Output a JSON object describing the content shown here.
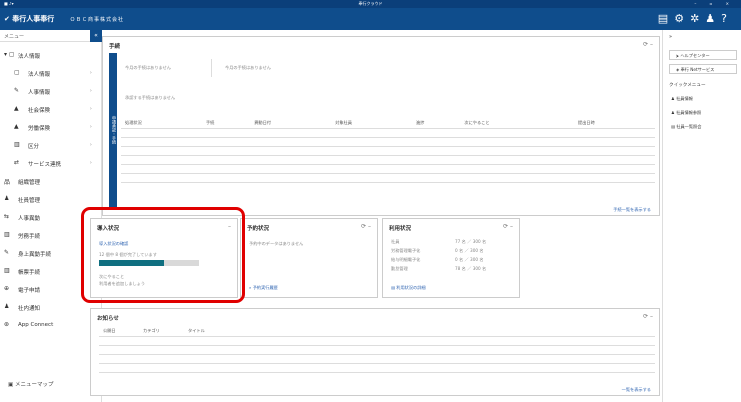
{
  "window": {
    "title": "奉行クラウド",
    "left_controls": "■ ♪▾",
    "right_controls": "– ▫ ×"
  },
  "header": {
    "logo": "✔ 奉行人事奉行",
    "company": "ＯＢＣ商事株式会社"
  },
  "sidebar": {
    "menu_label": "メニュー",
    "collapse": "«",
    "items": [
      {
        "label": "法人情報",
        "icon": "▾ ▢"
      },
      {
        "label": "法人情報",
        "icon": "▢"
      },
      {
        "label": "人事情報",
        "icon": "✎"
      },
      {
        "label": "社会保険",
        "icon": "▲"
      },
      {
        "label": "労働保険",
        "icon": "▲"
      },
      {
        "label": "区分",
        "icon": "▥"
      },
      {
        "label": "サービス連携",
        "icon": "⇄"
      },
      {
        "label": "組織管理",
        "icon": "品"
      },
      {
        "label": "社員管理",
        "icon": "♟"
      },
      {
        "label": "人事異動",
        "icon": "⇆"
      },
      {
        "label": "労務手続",
        "icon": "▥"
      },
      {
        "label": "身上異動手続",
        "icon": "✎"
      },
      {
        "label": "帳票手続",
        "icon": "▥"
      },
      {
        "label": "電子申請",
        "icon": "⊕"
      },
      {
        "label": "社内通知",
        "icon": "♟"
      },
      {
        "label": "App Connect",
        "icon": "⊛"
      }
    ],
    "map_button": "メニューマップ"
  },
  "procedures": {
    "title": "手続",
    "side_tab": "申請承認・手続",
    "msg1": "今月の手続はありません",
    "msg2": "今月の手続はありません",
    "msg3": "承認する手続はありません",
    "columns": [
      "処理状況",
      "手続",
      "異動日付",
      "対象社員",
      "進捗",
      "次にやること",
      "提出日時"
    ],
    "footer_link": "手続一覧を表示する"
  },
  "intro": {
    "title": "導入状況",
    "link": "導入状況の確認",
    "progress_text": "12 個中 8 個が完了しています",
    "progress_value": 0.65,
    "next_label": "次にやること",
    "next_item": "利用者を追加しましょう"
  },
  "schedule": {
    "title": "予約状況",
    "msg": "予約中のデータはありません",
    "link": "予約実行履歴"
  },
  "usage": {
    "title": "利用状況",
    "rows": [
      {
        "label": "社員",
        "value": "77 名 ／ 300 名"
      },
      {
        "label": "労務管理電子化",
        "value": "0 名 ／ 300 名"
      },
      {
        "label": "給与明細電子化",
        "value": "0 名 ／ 300 名"
      },
      {
        "label": "勤怠管理",
        "value": "78 名 ／ 300 名"
      }
    ],
    "link": "利用状況の詳細"
  },
  "notices": {
    "title": "お知らせ",
    "columns": [
      "公開日",
      "カテゴリ",
      "タイトル"
    ],
    "footer_link": "一覧を表示する"
  },
  "right_panel": {
    "help_center": "ヘルプセンター",
    "net_service": "奉行 Netサービス",
    "quick_label": "クイックメニュー",
    "quick_items": [
      "社員情報",
      "社員情報参照",
      "社員一覧照会"
    ]
  },
  "colors": {
    "brand": "#0f4d8c",
    "highlight": "#e00000",
    "progress": "#0f6f80"
  }
}
